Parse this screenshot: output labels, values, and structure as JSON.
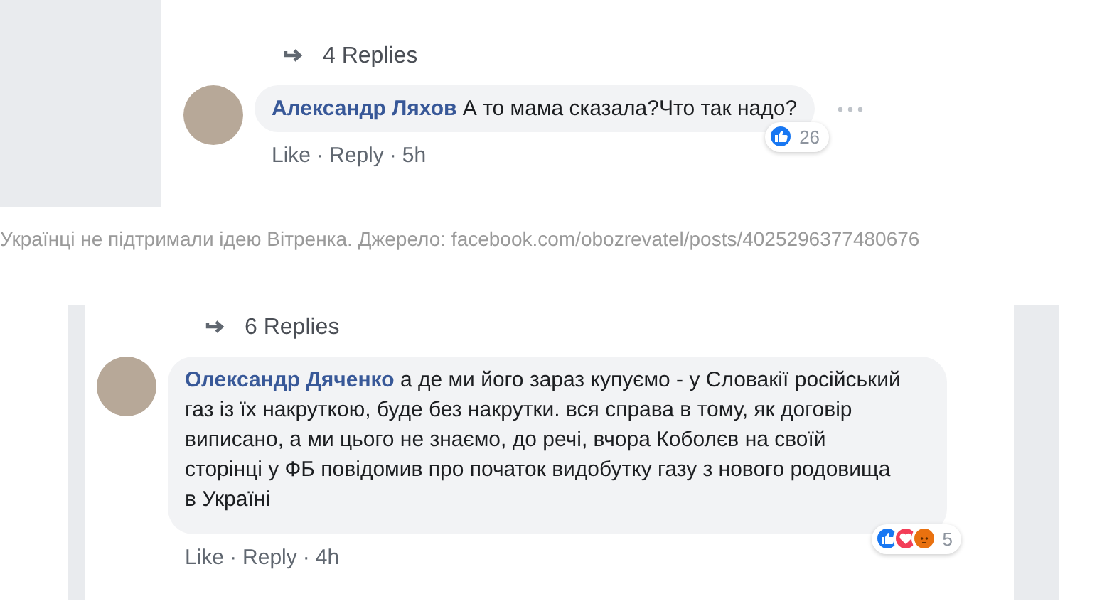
{
  "screenshots": [
    {
      "replies_link": "4 Replies",
      "comment": {
        "author": "Александр Ляхов",
        "text": "А то мама сказала?Что так надо?",
        "menu": true,
        "actions": [
          "Like",
          "Reply",
          "5h"
        ],
        "reactions": {
          "icons": [
            {
              "kind": "like"
            }
          ],
          "count": "26"
        }
      }
    },
    {
      "replies_link": "6 Replies",
      "comment": {
        "author": "Олександр Дяченко",
        "text": "а де ми його зараз купуємо - у Словакії російський газ із їх накруткою, буде без накрутки. вся справа в тому, як договір виписано, а ми цього не знаємо, до речі, вчора Коболєв на своїй сторінці у ФБ повідомив про початок видобутку газу з нового родовища в Україні",
        "actions": [
          "Like",
          "Reply",
          "4h"
        ],
        "reactions": {
          "icons": [
            {
              "kind": "like"
            },
            {
              "kind": "love"
            },
            {
              "kind": "angry"
            }
          ],
          "count": "5"
        }
      }
    }
  ],
  "separator": "·",
  "caption": "Українці не підтримали ідею Вітренка. Джерело: facebook.com/obozrevatel/posts/4025296377480676"
}
